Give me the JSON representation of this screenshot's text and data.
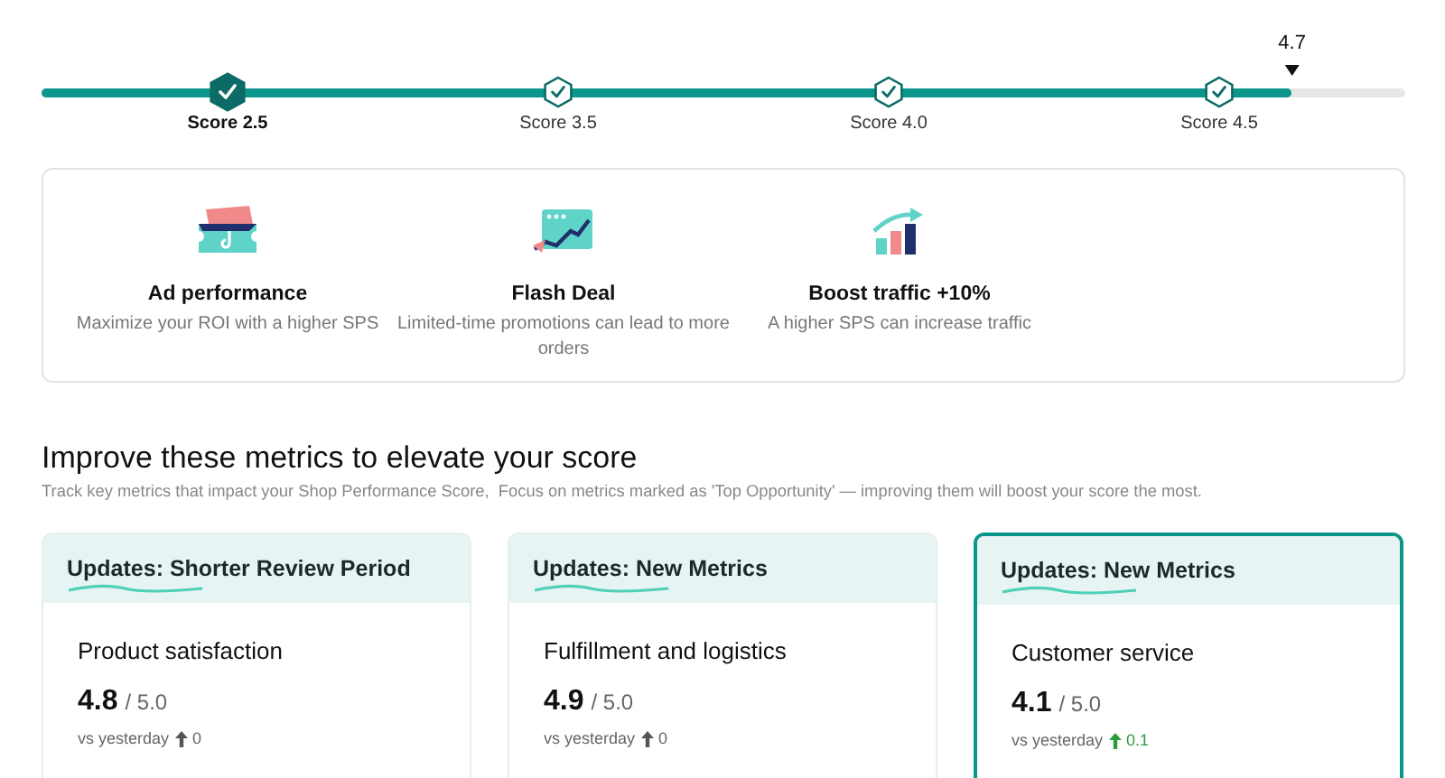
{
  "progress": {
    "level": 0.917,
    "current_score": "4.7",
    "milestones": [
      {
        "label": "Score 2.5",
        "selected": true
      },
      {
        "label": "Score 3.5",
        "selected": false
      },
      {
        "label": "Score 4.0",
        "selected": false
      },
      {
        "label": "Score 4.5",
        "selected": false
      }
    ]
  },
  "benefits": [
    {
      "kind": "ad",
      "title": "Ad performance",
      "description": "Maximize your ROI with a higher SPS"
    },
    {
      "kind": "deal",
      "title": "Flash Deal",
      "description": "Limited-time promotions can lead to more orders"
    },
    {
      "kind": "traffic",
      "title": "Boost traffic +10%",
      "description": "A higher SPS can increase traffic"
    }
  ],
  "section": {
    "title": "Improve these metrics to elevate your score",
    "subtitle": "Track key metrics that impact your Shop Performance Score,  Focus on metrics marked as 'Top Opportunity' — improving them will boost your score the most."
  },
  "metrics": [
    {
      "update": "Updates: Shorter Review Period",
      "name": "Product satisfaction",
      "score": "4.8",
      "max": "/ 5.0",
      "comparison": "vs yesterday",
      "change": "0",
      "positive": false,
      "selected": false
    },
    {
      "update": "Updates: New Metrics",
      "name": "Fulfillment and logistics",
      "score": "4.9",
      "max": "/ 5.0",
      "comparison": "vs yesterday",
      "change": "0",
      "positive": false,
      "selected": false
    },
    {
      "update": "Updates: New Metrics",
      "name": "Customer service",
      "score": "4.1",
      "max": "/ 5.0",
      "comparison": "vs yesterday",
      "change": "0.1",
      "positive": true,
      "selected": true
    }
  ]
}
